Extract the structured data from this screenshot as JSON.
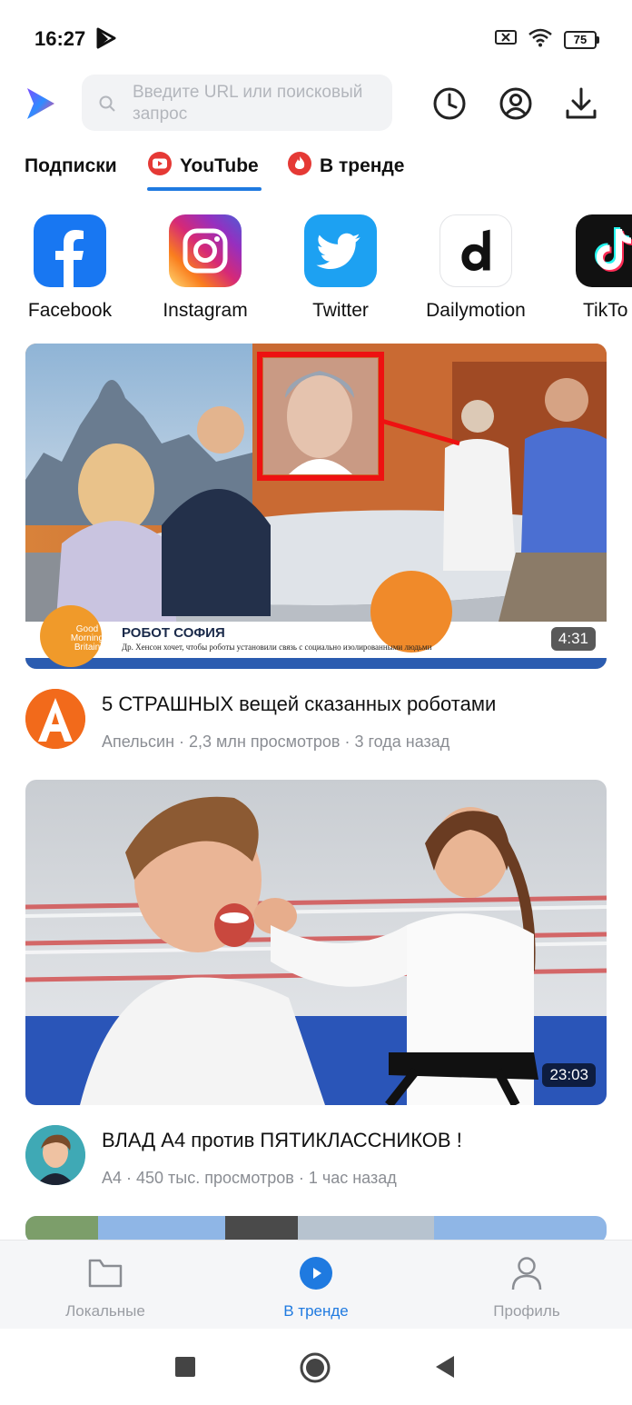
{
  "status_bar": {
    "time": "16:27",
    "battery": "75",
    "icons": [
      "play-store-icon",
      "sim-blocked-icon",
      "wifi-icon",
      "battery-icon"
    ]
  },
  "search": {
    "placeholder": "Введите URL или поисковый запрос"
  },
  "top_icons": [
    "history-icon",
    "account-icon",
    "download-icon"
  ],
  "tabs": [
    {
      "label": "Подписки",
      "active": false
    },
    {
      "label": "YouTube",
      "active": true,
      "icon": "youtube-icon"
    },
    {
      "label": "В тренде",
      "active": false,
      "icon": "fire-icon"
    }
  ],
  "sites": [
    {
      "label": "Facebook",
      "icon": "facebook-icon",
      "color": "#1877f2"
    },
    {
      "label": "Instagram",
      "icon": "instagram-icon",
      "color": "#e1306c"
    },
    {
      "label": "Twitter",
      "icon": "twitter-icon",
      "color": "#1da1f2"
    },
    {
      "label": "Dailymotion",
      "icon": "dailymotion-icon",
      "color": "#000000"
    },
    {
      "label": "TikTo",
      "icon": "tiktok-icon",
      "color": "#111111"
    }
  ],
  "videos": [
    {
      "title": "5 СТРАШНЫХ вещей сказанных роботами",
      "meta": "Апельсин · 2,3 млн просмотров · 3 года назад",
      "duration": "4:31",
      "caption_title": "РОБОТ СОФИЯ",
      "caption_sub": "Др. Хенсон хочет, чтобы роботы установили связь с социально изолированными людьми",
      "caption_brand": "Good Morning Britain"
    },
    {
      "title": "ВЛАД А4 против ПЯТИКЛАССНИКОВ !",
      "meta": "А4 · 450 тыс. просмотров · 1 час назад",
      "duration": "23:03"
    }
  ],
  "bottom_nav": [
    {
      "label": "Локальные",
      "icon": "folder-icon",
      "active": false
    },
    {
      "label": "В тренде",
      "icon": "play-circle-icon",
      "active": true
    },
    {
      "label": "Профиль",
      "icon": "profile-icon",
      "active": false
    }
  ],
  "colors": {
    "accent": "#1f7ae0",
    "youtube_red": "#e53935",
    "muted_text": "#8a8d93"
  }
}
